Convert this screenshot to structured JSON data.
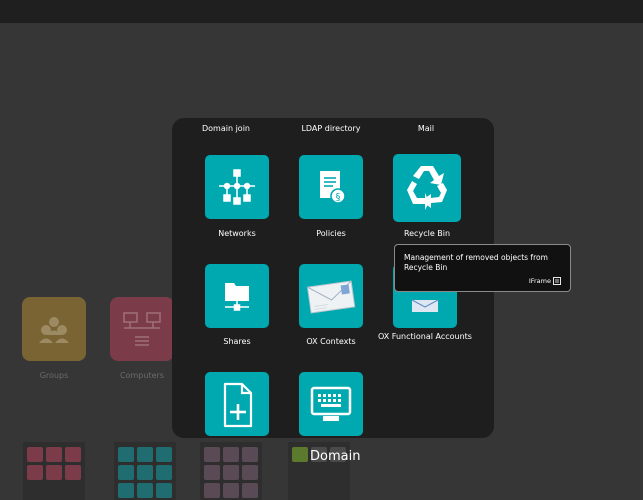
{
  "background": {
    "apps": [
      {
        "label": "Groups",
        "icon": "groups-icon",
        "color": "#7a6433"
      },
      {
        "label": "Computers",
        "icon": "computers-icon",
        "color": "#7b3b48"
      }
    ]
  },
  "folder": {
    "title": "Domain",
    "top_labels": [
      "Domain join",
      "LDAP directory",
      "Mail"
    ],
    "apps": [
      {
        "label": "Networks",
        "icon": "network-icon"
      },
      {
        "label": "Policies",
        "icon": "policy-document-icon"
      },
      {
        "label": "Recycle Bin",
        "icon": "recycle-icon"
      },
      {
        "label": "Shares",
        "icon": "shared-folder-icon"
      },
      {
        "label": "OX Contexts",
        "icon": "envelope-icon"
      },
      {
        "label": "OX Functional Accounts",
        "icon": "mail-account-icon"
      },
      {
        "label": "",
        "icon": "new-document-icon"
      },
      {
        "label": "",
        "icon": "monitor-keyboard-icon"
      }
    ]
  },
  "tooltip": {
    "description": "Management of removed objects from Recycle Bin",
    "type": "IFrame",
    "type_icon": "iframe-icon"
  },
  "colors": {
    "accent": "#00a9b0",
    "modal_bg": "#1e1e1e",
    "page_bg": "#363636"
  }
}
